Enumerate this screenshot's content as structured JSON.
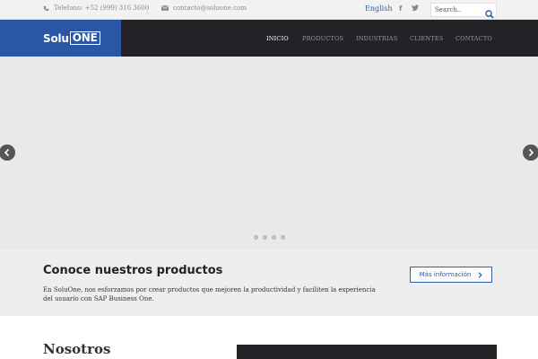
{
  "topbar": {
    "phone": "Telefono: +52 (999) 316 3600",
    "email": "contacto@soluone.com",
    "language": "English",
    "search_placeholder": "Search.."
  },
  "logo": {
    "part1": "Solu",
    "part2": "ONE"
  },
  "nav": {
    "items": [
      {
        "label": "INICIO",
        "active": true
      },
      {
        "label": "PRODUCTOS"
      },
      {
        "label": "INDUSTRIAS"
      },
      {
        "label": "CLIENTES"
      },
      {
        "label": "CONTACTO"
      }
    ]
  },
  "slider": {
    "slide_count": 4,
    "active_slide": 1
  },
  "products_band": {
    "title": "Conoce nuestros productos",
    "text": "En SoluOne, nos esforzamos por crear productos que mejoren la productividad y faciliten la experiencia del usuario con SAP Business One.",
    "button": "Más información"
  },
  "about": {
    "title": "Nosotros"
  },
  "colors": {
    "brand_blue": "#2a56a3",
    "nav_dark": "#232226",
    "link_blue": "#2d5fa4"
  }
}
